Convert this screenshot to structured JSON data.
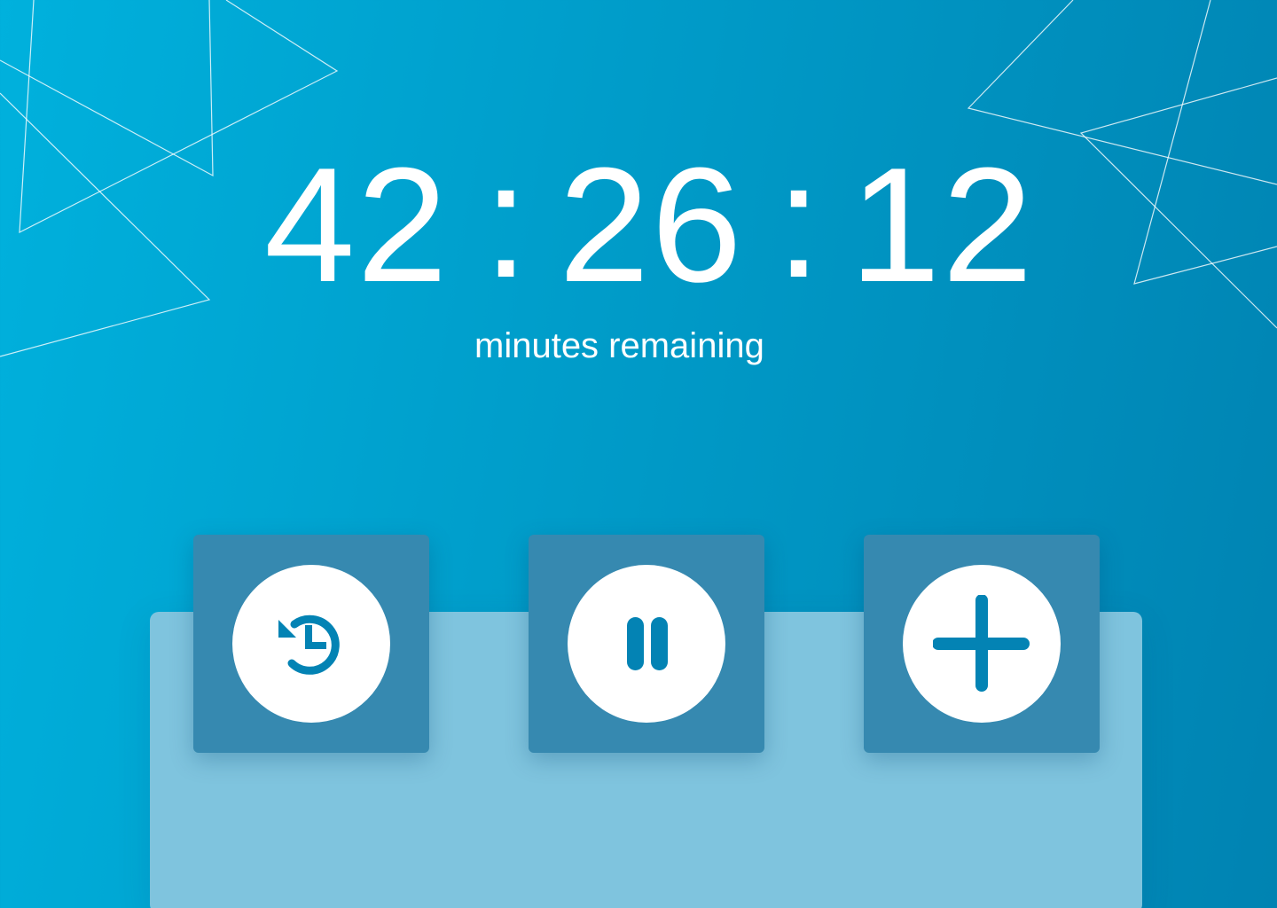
{
  "timer": {
    "hours": "42",
    "minutes": "26",
    "seconds": "12",
    "separator": ":",
    "subtitle": "minutes remaining"
  },
  "controls": [
    {
      "name": "restart",
      "icon": "history-icon"
    },
    {
      "name": "pause",
      "icon": "pause-icon"
    },
    {
      "name": "add-time",
      "icon": "plus-icon"
    }
  ],
  "colors": {
    "background_start": "#00b1dd",
    "background_end": "#0083b2",
    "panel": "#7fc4de",
    "control_tile": "#3689b0",
    "icon_accent": "#0383b4",
    "text": "#ffffff"
  }
}
